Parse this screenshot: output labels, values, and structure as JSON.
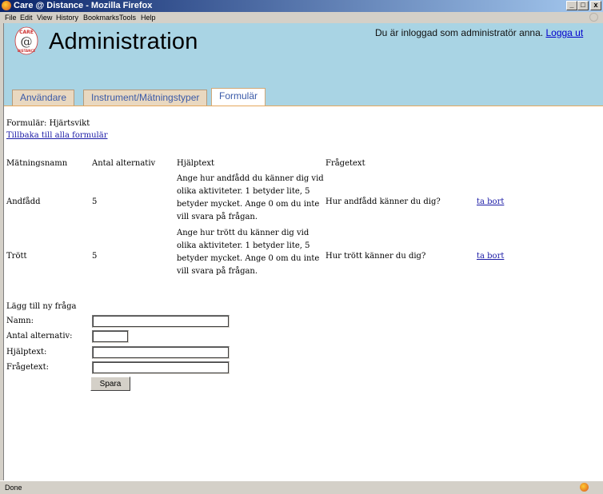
{
  "window": {
    "title": "Care @ Distance - Mozilla Firefox",
    "minimize": "_",
    "maximize": "□",
    "close": "x"
  },
  "menu": [
    "File",
    "Edit",
    "View",
    "History",
    "Bookmarks",
    "Tools",
    "Help"
  ],
  "header": {
    "logo_top": "CARE",
    "logo_at": "@",
    "logo_bottom": "DISTANCE",
    "title": "Administration",
    "logged_in_text": "Du är inloggad som administratör anna.",
    "logout": "Logga ut"
  },
  "tabs": [
    {
      "label": "Användare",
      "active": false
    },
    {
      "label": "Instrument/Mätningstyper",
      "active": false
    },
    {
      "label": "Formulär",
      "active": true
    }
  ],
  "form": {
    "heading": "Formulär: Hjärtsvikt",
    "back_link": "Tillbaka till alla formulär"
  },
  "table": {
    "headers": [
      "Mätningsnamn",
      "Antal alternativ",
      "Hjälptext",
      "Frågetext"
    ],
    "rows": [
      {
        "name": "Andfådd",
        "count": "5",
        "help": "Ange hur andfådd du känner dig vid olika aktiviteter. 1 betyder lite, 5 betyder mycket. Ange 0 om du inte vill svara på frågan.",
        "question": "Hur andfådd känner du dig?",
        "delete": "ta bort"
      },
      {
        "name": "Trött",
        "count": "5",
        "help": "Ange hur trött du känner dig vid olika aktiviteter. 1 betyder lite, 5 betyder mycket. Ange 0 om du inte vill svara på frågan.",
        "question": "Hur trött känner du dig?",
        "delete": "ta bort"
      }
    ]
  },
  "new_question": {
    "heading": "Lägg till ny fråga",
    "name_label": "Namn:",
    "count_label": "Antal alternativ:",
    "help_label": "Hjälptext:",
    "question_label": "Frågetext:",
    "name_value": "",
    "count_value": "",
    "help_value": "",
    "question_value": "",
    "save_label": "Spara"
  },
  "status": {
    "text": "Done"
  },
  "colors": {
    "header_bg": "#a9d4e4",
    "tab_bg": "#e9d8c0",
    "tab_text": "#3a5aa8",
    "link": "#1a1aa6"
  }
}
